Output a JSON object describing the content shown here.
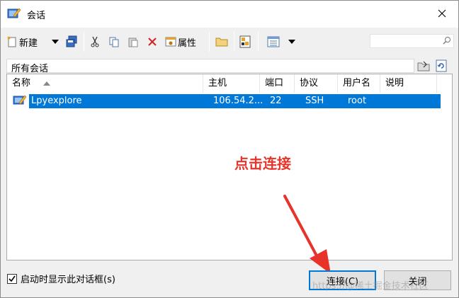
{
  "window": {
    "title": "会话"
  },
  "toolbar": {
    "new_label": "新建",
    "properties_label": "属性",
    "search_placeholder": ""
  },
  "group": {
    "label": "所有会话"
  },
  "table": {
    "columns": [
      "名称",
      "主机",
      "端口",
      "协议",
      "用户名",
      "说明"
    ],
    "rows": [
      {
        "name": "Lpyexplore",
        "host": "106.54.2...",
        "port": "22",
        "protocol": "SSH",
        "username": "root",
        "description": ""
      }
    ]
  },
  "annotation": {
    "text": "点击连接",
    "color": "#e8332b"
  },
  "footer": {
    "startup_checkbox_label": "启动时显示此对话框(s)",
    "startup_checked": true,
    "connect_label": "连接(C)",
    "close_label": "关闭"
  },
  "watermark": {
    "text": "https://@稀土掘金技术社区"
  },
  "colors": {
    "selection": "#0078d7",
    "background": "#f0f0f0"
  }
}
